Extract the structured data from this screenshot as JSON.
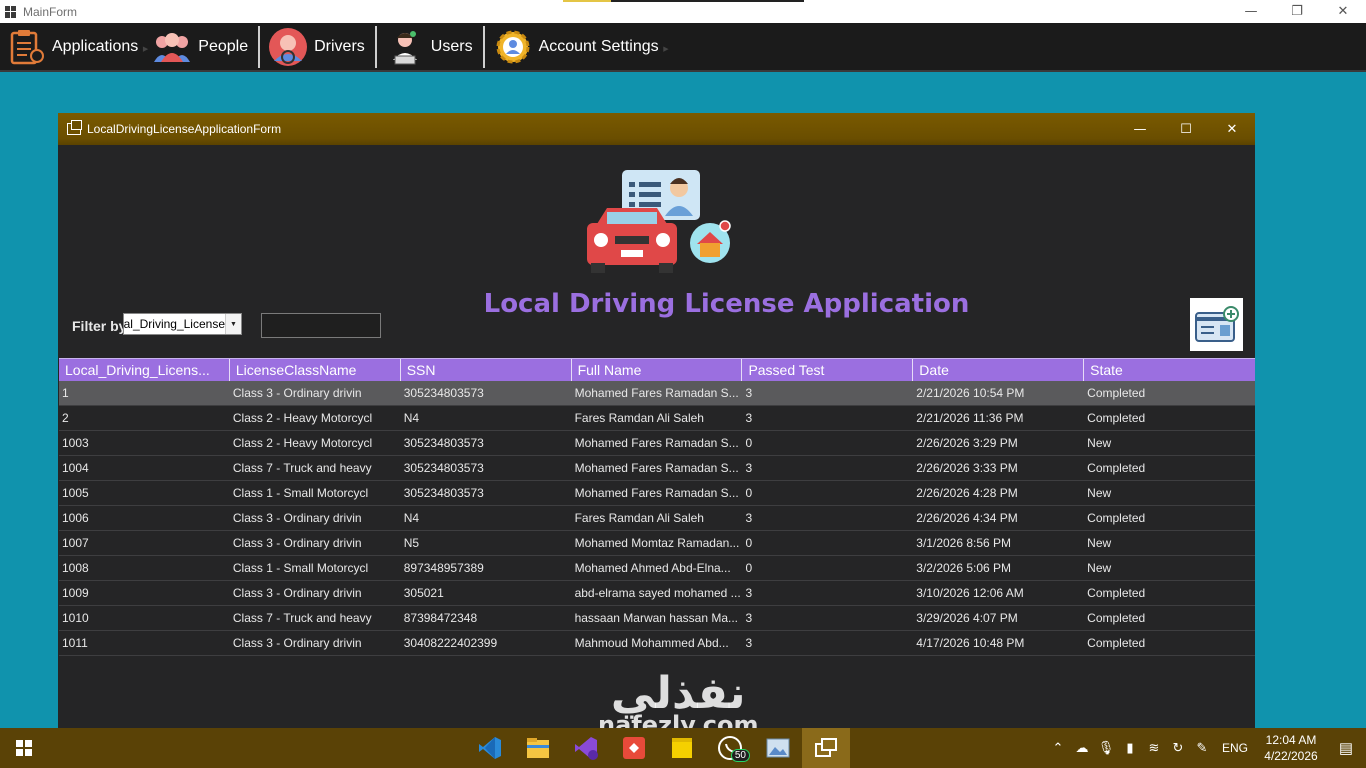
{
  "main_window": {
    "title": "MainForm"
  },
  "menu": {
    "items": [
      {
        "label": "Applications",
        "icon": "clipboard-icon"
      },
      {
        "label": "People",
        "icon": "people-icon"
      },
      {
        "label": "Drivers",
        "icon": "driver-icon"
      },
      {
        "label": "Users",
        "icon": "user-icon"
      },
      {
        "label": "Account Settings",
        "icon": "gear-icon"
      }
    ]
  },
  "child_window": {
    "title": "LocalDrivingLicenseApplicationForm",
    "heading": "Local Driving License Application",
    "filter": {
      "label": "Filter by:",
      "selected": "Local_Driving_License",
      "input_value": ""
    }
  },
  "grid": {
    "columns": [
      "Local_Driving_Licens...",
      "LicenseClassName",
      "SSN",
      "Full Name",
      "Passed Test",
      "Date",
      "State"
    ],
    "rows": [
      [
        "1",
        "Class 3 - Ordinary drivin",
        "305234803573",
        "Mohamed Fares  Ramadan  S...",
        "3",
        "2/21/2026 10:54 PM",
        "Completed"
      ],
      [
        "2",
        "Class 2 - Heavy Motorcycl",
        "N4",
        "Fares Ramdan Ali Saleh",
        "3",
        "2/21/2026 11:36 PM",
        "Completed"
      ],
      [
        "1003",
        "Class 2 - Heavy Motorcycl",
        "305234803573",
        "Mohamed Fares  Ramadan  S...",
        "0",
        "2/26/2026 3:29 PM",
        "New"
      ],
      [
        "1004",
        "Class 7 - Truck and heavy",
        "305234803573",
        "Mohamed Fares  Ramadan  S...",
        "3",
        "2/26/2026 3:33 PM",
        "Completed"
      ],
      [
        "1005",
        "Class 1 - Small Motorcycl",
        "305234803573",
        "Mohamed Fares  Ramadan  S...",
        "0",
        "2/26/2026 4:28 PM",
        "New"
      ],
      [
        "1006",
        "Class 3 - Ordinary drivin",
        "N4",
        "Fares Ramdan Ali Saleh",
        "3",
        "2/26/2026 4:34 PM",
        "Completed"
      ],
      [
        "1007",
        "Class 3 - Ordinary drivin",
        "N5",
        "Mohamed Momtaz Ramadan...",
        "0",
        "3/1/2026 8:56 PM",
        "New"
      ],
      [
        "1008",
        "Class 1 - Small Motorcycl",
        "897348957389",
        "Mohamed Ahmed Abd-Elna...",
        "0",
        "3/2/2026 5:06 PM",
        "New"
      ],
      [
        "1009",
        "Class 3 - Ordinary drivin",
        "305021",
        "abd-elrama sayed mohamed ...",
        "3",
        "3/10/2026 12:06 AM",
        "Completed"
      ],
      [
        "1010",
        "Class 7 - Truck and heavy",
        "87398472348",
        "hassaan Marwan  hassan  Ma...",
        "3",
        "3/29/2026 4:07 PM",
        "Completed"
      ],
      [
        "1011",
        "Class 3 - Ordinary drivin",
        "30408222402399",
        "Mahmoud Mohammed Abd...",
        "3",
        "4/17/2026 10:48 PM",
        "Completed"
      ]
    ]
  },
  "taskbar": {
    "apps": [
      "vscode-icon",
      "file-explorer-icon",
      "visual-studio-icon",
      "anydesk-icon",
      "sticky-notes-icon",
      "whatsapp-icon",
      "image-viewer-icon",
      "window-app-icon"
    ],
    "whatsapp_badge": "50",
    "language": "ENG",
    "time": "12:04 AM",
    "date": "4/22/2026"
  },
  "watermark": {
    "arabic": "نفذلي",
    "latin": "nafezly.com"
  },
  "colors": {
    "accent_purple": "#9b6fe0",
    "child_titlebar": "#6a4e00",
    "desktop": "#1093ad",
    "taskbar": "#5a4206"
  }
}
